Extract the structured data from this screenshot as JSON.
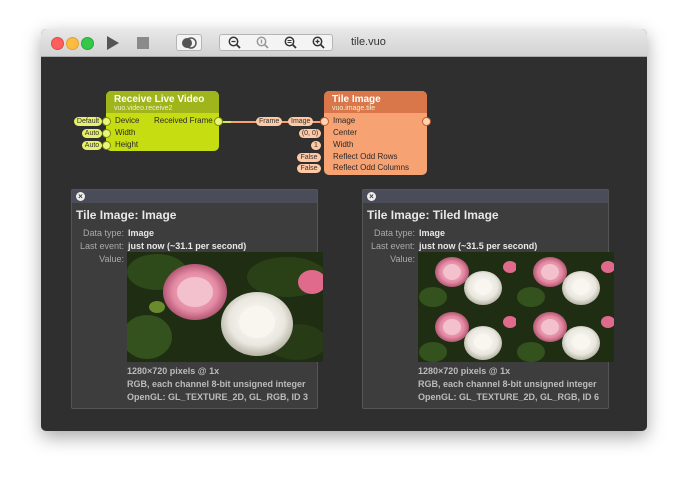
{
  "window": {
    "title": "tile.vuo"
  },
  "toolbar": {
    "run_icon": "play-icon",
    "stop_icon": "stop-icon",
    "show_events_icon": "show-events-icon",
    "zoom_out_icon": "zoom-out-icon",
    "zoom_actual_icon": "zoom-actual-size-icon",
    "zoom_fit_icon": "zoom-to-fit-icon",
    "zoom_in_icon": "zoom-in-icon"
  },
  "nodes": {
    "receive": {
      "title": "Receive Live Video",
      "class_name": "vuo.video.receive2",
      "inputs": [
        {
          "label": "Device",
          "value": "Default"
        },
        {
          "label": "Width",
          "value": "Auto"
        },
        {
          "label": "Height",
          "value": "Auto"
        }
      ],
      "output": "Received Frame"
    },
    "tile": {
      "title": "Tile Image",
      "class_name": "vuo.image.tile",
      "inputs": [
        {
          "label": "Image",
          "value": ""
        },
        {
          "label": "Center",
          "value": "(0, 0)"
        },
        {
          "label": "Width",
          "value": "1"
        },
        {
          "label": "Reflect Odd Rows",
          "value": "False"
        },
        {
          "label": "Reflect Odd Columns",
          "value": "False"
        }
      ]
    },
    "cable_labels": {
      "from": "Frame",
      "to": "Image"
    }
  },
  "popovers": [
    {
      "title": "Tile Image: Image",
      "data_type_label": "Data type:",
      "data_type": "Image",
      "last_event_label": "Last event:",
      "last_event": "just now (~31.1 per second)",
      "value_label": "Value:",
      "info_lines": [
        "1280×720 pixels @ 1x",
        "RGB, each channel 8-bit unsigned integer",
        "OpenGL: GL_TEXTURE_2D, GL_RGB, ID 3"
      ]
    },
    {
      "title": "Tile Image: Tiled Image",
      "data_type_label": "Data type:",
      "data_type": "Image",
      "last_event_label": "Last event:",
      "last_event": "just now (~31.5 per second)",
      "value_label": "Value:",
      "info_lines": [
        "1280×720 pixels @ 1x",
        "RGB, each channel 8-bit unsigned integer",
        "OpenGL: GL_TEXTURE_2D, GL_RGB, ID 6"
      ]
    }
  ],
  "colors": {
    "canvas_bg": "#2f2f2f",
    "receive_node": "#c6dd12",
    "tile_node": "#f7a273"
  }
}
